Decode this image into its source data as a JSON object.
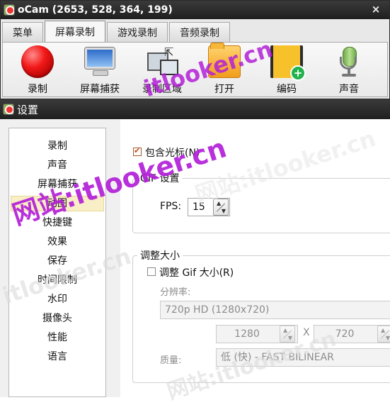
{
  "ocam": {
    "title": "oCam (2653, 528, 364, 199)",
    "close": "×",
    "tabs": [
      "菜单",
      "屏幕录制",
      "游戏录制",
      "音频录制"
    ],
    "active_tab": "屏幕录制",
    "tools": [
      {
        "label": "录制",
        "icon": "record-icon"
      },
      {
        "label": "屏幕捕获",
        "icon": "monitor-icon"
      },
      {
        "label": "录制区域",
        "icon": "capture-area-icon"
      },
      {
        "label": "打开",
        "icon": "folder-icon"
      },
      {
        "label": "编码",
        "icon": "film-plus-icon"
      },
      {
        "label": "声音",
        "icon": "microphone-icon"
      }
    ]
  },
  "settings": {
    "title": "设置",
    "nav": [
      "录制",
      "声音",
      "屏幕捕获",
      "动图",
      "快捷键",
      "效果",
      "保存",
      "时间限制",
      "水印",
      "摄像头",
      "性能",
      "语言"
    ],
    "selected_nav": "动图",
    "include_cursor": {
      "label": "包含光标(N)",
      "checked": true
    },
    "gif_group": {
      "title": "GIF 设置",
      "fps_label": "FPS:",
      "fps_value": "15"
    },
    "resize_group": {
      "title": "调整大小",
      "resize_gif": {
        "label": "调整 Gif 大小(R)",
        "checked": false
      },
      "resolution_label": "分辨率:",
      "resolution_value": "720p HD (1280x720)",
      "width": "1280",
      "times": "X",
      "height": "720",
      "quality_label": "质量:",
      "quality_value": "低 (快) - FAST BILINEAR"
    }
  },
  "watermark": {
    "text_a": "网站:itlooker.cn",
    "text_b": "itlooker.cn",
    "color": "#b31fd8"
  }
}
